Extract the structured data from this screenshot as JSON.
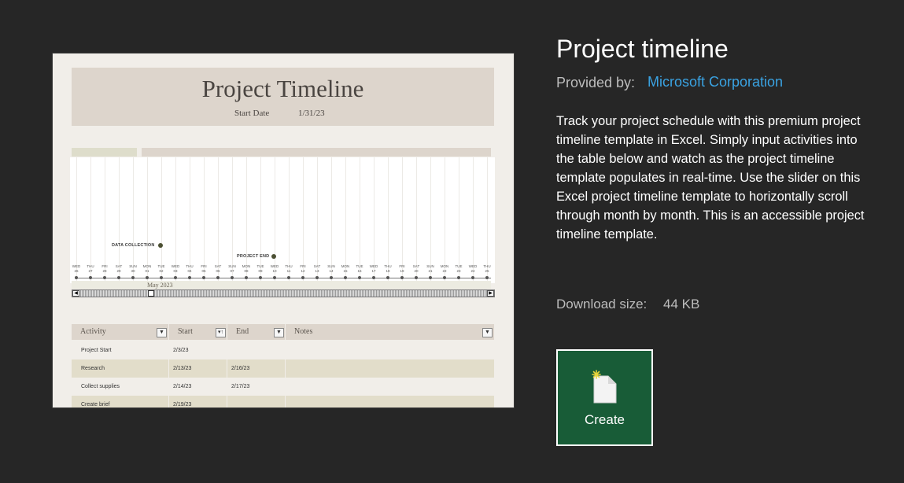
{
  "template": {
    "title": "Project timeline",
    "provided_by_label": "Provided by:",
    "provider": "Microsoft Corporation",
    "description": "Track your project schedule with this premium project timeline template in Excel. Simply input activities into the table below and watch as the project timeline template populates in real-time. Use the slider on this Excel project timeline template to horizontally scroll through month by month. This is an accessible project timeline template.",
    "download_size_label": "Download size:",
    "download_size_value": "44 KB",
    "create_label": "Create"
  },
  "preview": {
    "title": "Project Timeline",
    "start_date_label": "Start Date",
    "start_date_value": "1/31/23",
    "milestones": [
      {
        "label": "DATA COLLECTION"
      },
      {
        "label": "PROJECT END"
      }
    ],
    "days": [
      {
        "dow": "WED",
        "date": "26"
      },
      {
        "dow": "THU",
        "date": "27"
      },
      {
        "dow": "FRI",
        "date": "28"
      },
      {
        "dow": "SAT",
        "date": "29"
      },
      {
        "dow": "SUN",
        "date": "30"
      },
      {
        "dow": "MON",
        "date": "01"
      },
      {
        "dow": "TUE",
        "date": "02"
      },
      {
        "dow": "WED",
        "date": "03"
      },
      {
        "dow": "THU",
        "date": "04"
      },
      {
        "dow": "FRI",
        "date": "05"
      },
      {
        "dow": "SAT",
        "date": "06"
      },
      {
        "dow": "SUN",
        "date": "07"
      },
      {
        "dow": "MON",
        "date": "08"
      },
      {
        "dow": "TUE",
        "date": "09"
      },
      {
        "dow": "WED",
        "date": "10"
      },
      {
        "dow": "THU",
        "date": "11"
      },
      {
        "dow": "FRI",
        "date": "12"
      },
      {
        "dow": "SAT",
        "date": "13"
      },
      {
        "dow": "SUN",
        "date": "14"
      },
      {
        "dow": "MON",
        "date": "15"
      },
      {
        "dow": "TUE",
        "date": "16"
      },
      {
        "dow": "WED",
        "date": "17"
      },
      {
        "dow": "THU",
        "date": "18"
      },
      {
        "dow": "FRI",
        "date": "19"
      },
      {
        "dow": "SAT",
        "date": "20"
      },
      {
        "dow": "SUN",
        "date": "21"
      },
      {
        "dow": "MON",
        "date": "22"
      },
      {
        "dow": "TUE",
        "date": "23"
      },
      {
        "dow": "WED",
        "date": "24"
      },
      {
        "dow": "THU",
        "date": "25"
      }
    ],
    "month_label": "May 2023",
    "table": {
      "headers": [
        "Activity",
        "Start",
        "End",
        "Notes"
      ],
      "rows": [
        {
          "activity": "Project Start",
          "start": "2/3/23",
          "end": "",
          "notes": ""
        },
        {
          "activity": "Research",
          "start": "2/13/23",
          "end": "2/16/23",
          "notes": ""
        },
        {
          "activity": "Collect supplies",
          "start": "2/14/23",
          "end": "2/17/23",
          "notes": ""
        },
        {
          "activity": "Create brief",
          "start": "2/19/23",
          "end": "",
          "notes": ""
        }
      ]
    }
  }
}
